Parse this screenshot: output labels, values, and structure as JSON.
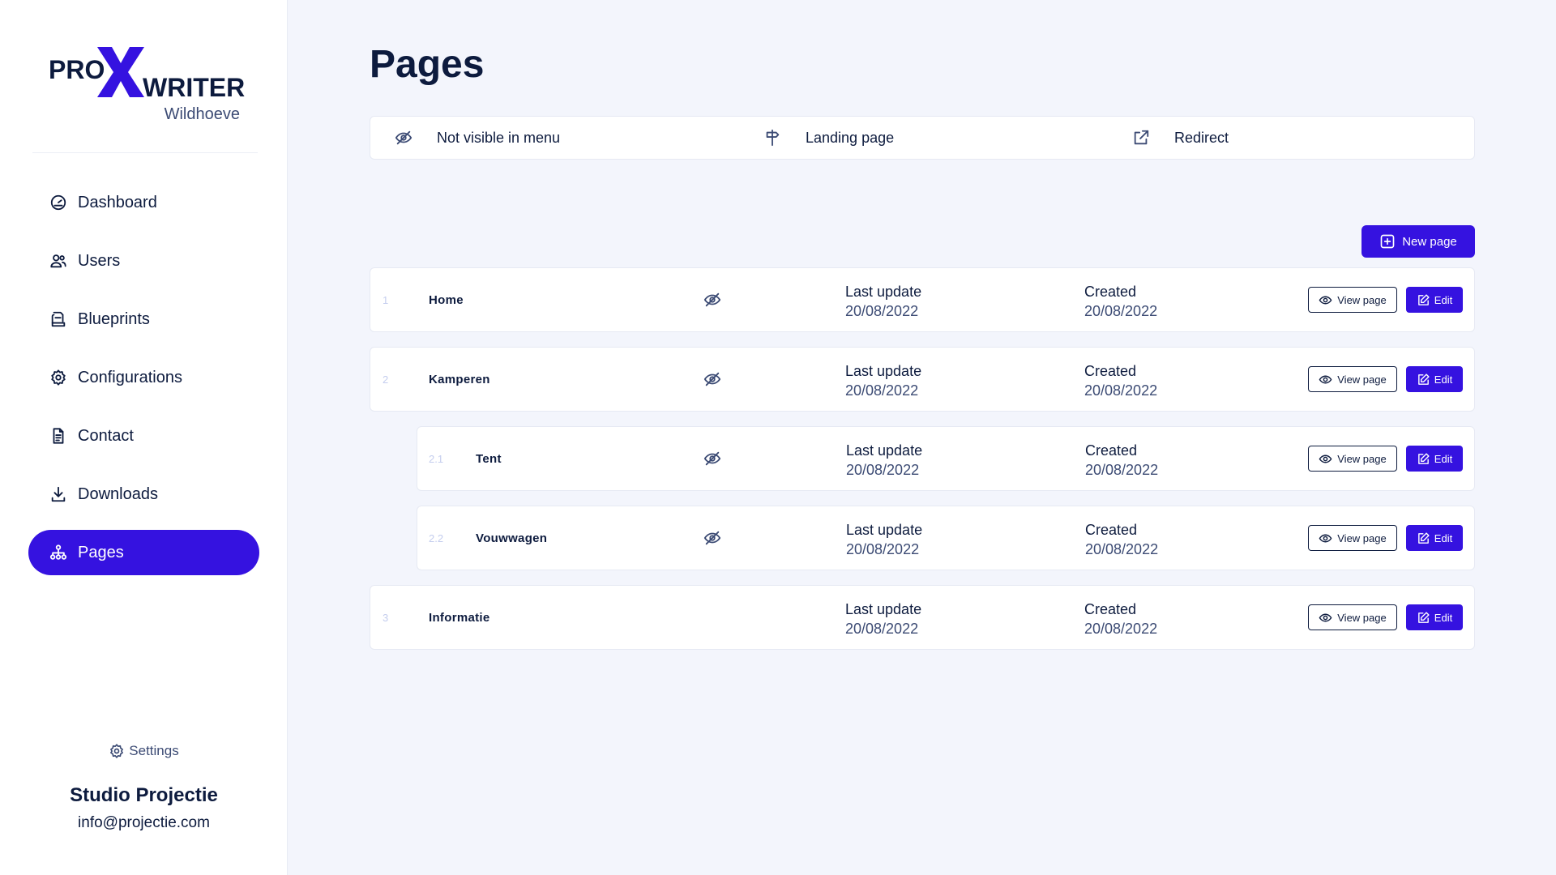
{
  "brand": {
    "logo_left": "PRO",
    "logo_mark": "X",
    "logo_right": "WRITER",
    "site": "Wildhoeve",
    "accent": "#3512e0"
  },
  "sidebar": {
    "items": [
      {
        "label": "Dashboard",
        "icon": "dashboard-icon",
        "active": false
      },
      {
        "label": "Users",
        "icon": "users-icon",
        "active": false
      },
      {
        "label": "Blueprints",
        "icon": "blueprints-icon",
        "active": false
      },
      {
        "label": "Configurations",
        "icon": "gear-icon",
        "active": false
      },
      {
        "label": "Contact",
        "icon": "document-icon",
        "active": false
      },
      {
        "label": "Downloads",
        "icon": "download-icon",
        "active": false
      },
      {
        "label": "Pages",
        "icon": "sitemap-icon",
        "active": true
      }
    ],
    "settings_label": "Settings",
    "company": "Studio Projectie",
    "email": "info@projectie.com"
  },
  "main": {
    "title": "Pages",
    "legend": [
      {
        "label": "Not visible in menu",
        "icon": "eye-off-icon"
      },
      {
        "label": "Landing page",
        "icon": "signpost-icon"
      },
      {
        "label": "Redirect",
        "icon": "external-link-icon"
      }
    ],
    "new_page_label": "New page",
    "pages": [
      {
        "num": "1",
        "name": "Home",
        "hidden": true,
        "last_update_label": "Last update",
        "last_update": "20/08/2022",
        "created_label": "Created",
        "created": "20/08/2022",
        "view_label": "View page",
        "edit_label": "Edit"
      },
      {
        "num": "2",
        "name": "Kamperen",
        "hidden": true,
        "last_update_label": "Last update",
        "last_update": "20/08/2022",
        "created_label": "Created",
        "created": "20/08/2022",
        "view_label": "View page",
        "edit_label": "Edit"
      },
      {
        "num": "2.1",
        "name": "Tent",
        "hidden": true,
        "last_update_label": "Last update",
        "last_update": "20/08/2022",
        "created_label": "Created",
        "created": "20/08/2022",
        "view_label": "View page",
        "edit_label": "Edit"
      },
      {
        "num": "2.2",
        "name": "Vouwwagen",
        "hidden": true,
        "last_update_label": "Last update",
        "last_update": "20/08/2022",
        "created_label": "Created",
        "created": "20/08/2022",
        "view_label": "View page",
        "edit_label": "Edit"
      },
      {
        "num": "3",
        "name": "Informatie",
        "hidden": false,
        "last_update_label": "Last update",
        "last_update": "20/08/2022",
        "created_label": "Created",
        "created": "20/08/2022",
        "view_label": "View page",
        "edit_label": "Edit"
      }
    ]
  }
}
